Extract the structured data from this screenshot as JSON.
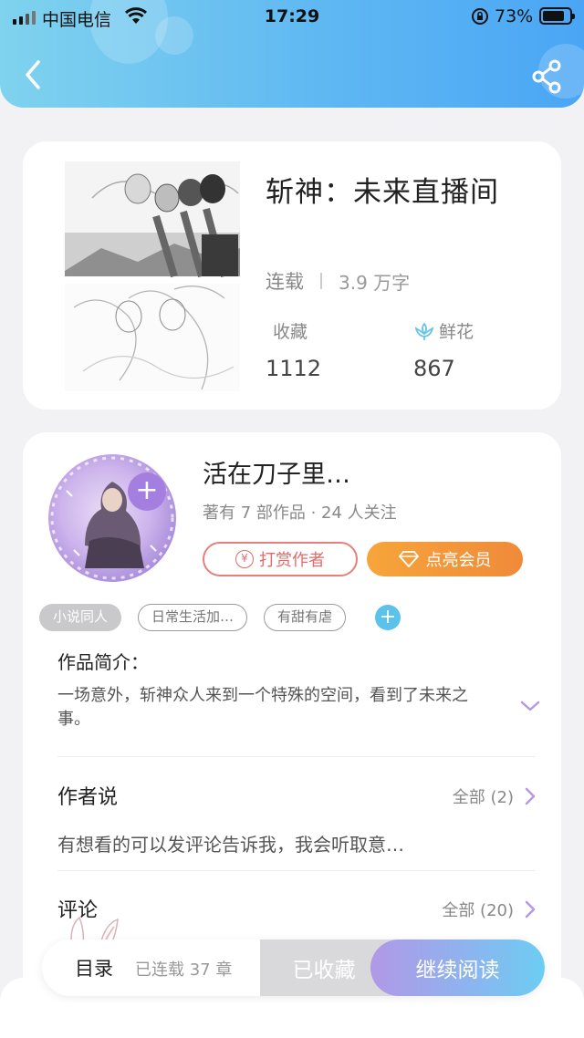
{
  "status_bar": {
    "carrier": "中国电信",
    "time": "17:29",
    "battery": "73%"
  },
  "header": {
    "back_icon": "chevron-left-icon",
    "share_icon": "share-icon"
  },
  "book": {
    "title": "斩神：未来直播间",
    "status": "连载",
    "word_count": "3.9 万字",
    "favorites_label": "收藏",
    "favorites_value": "1112",
    "flowers_label": "鲜花",
    "flowers_value": "867"
  },
  "author": {
    "name": "活在刀子里…",
    "meta": "著有 7 部作品 · 24 人关注",
    "reward_label": "打赏作者",
    "vip_label": "点亮会员"
  },
  "tags": [
    "小说同人",
    "日常生活加…",
    "有甜有虐"
  ],
  "intro": {
    "title": "作品简介：",
    "text": "一场意外，斩神众人来到一个特殊的空间，看到了未来之事。"
  },
  "author_say": {
    "title": "作者说",
    "more": "全部 (2)",
    "text": "有想看的可以发评论告诉我，我会听取意…"
  },
  "comments": {
    "title": "评论",
    "more": "全部 (20)"
  },
  "bottom_bar": {
    "toc_label": "目录",
    "chapter_count": "已连载 37 章",
    "collected_label": "已收藏",
    "continue_label": "继续阅读"
  },
  "colors": {
    "header_gradient_start": "#7fd3ee",
    "header_gradient_end": "#4aa6f5",
    "reward_red": "#e46a6a",
    "vip_orange": "#f08a3a",
    "read_gradient_start": "#b198e6",
    "read_gradient_end": "#6ccdf2"
  }
}
